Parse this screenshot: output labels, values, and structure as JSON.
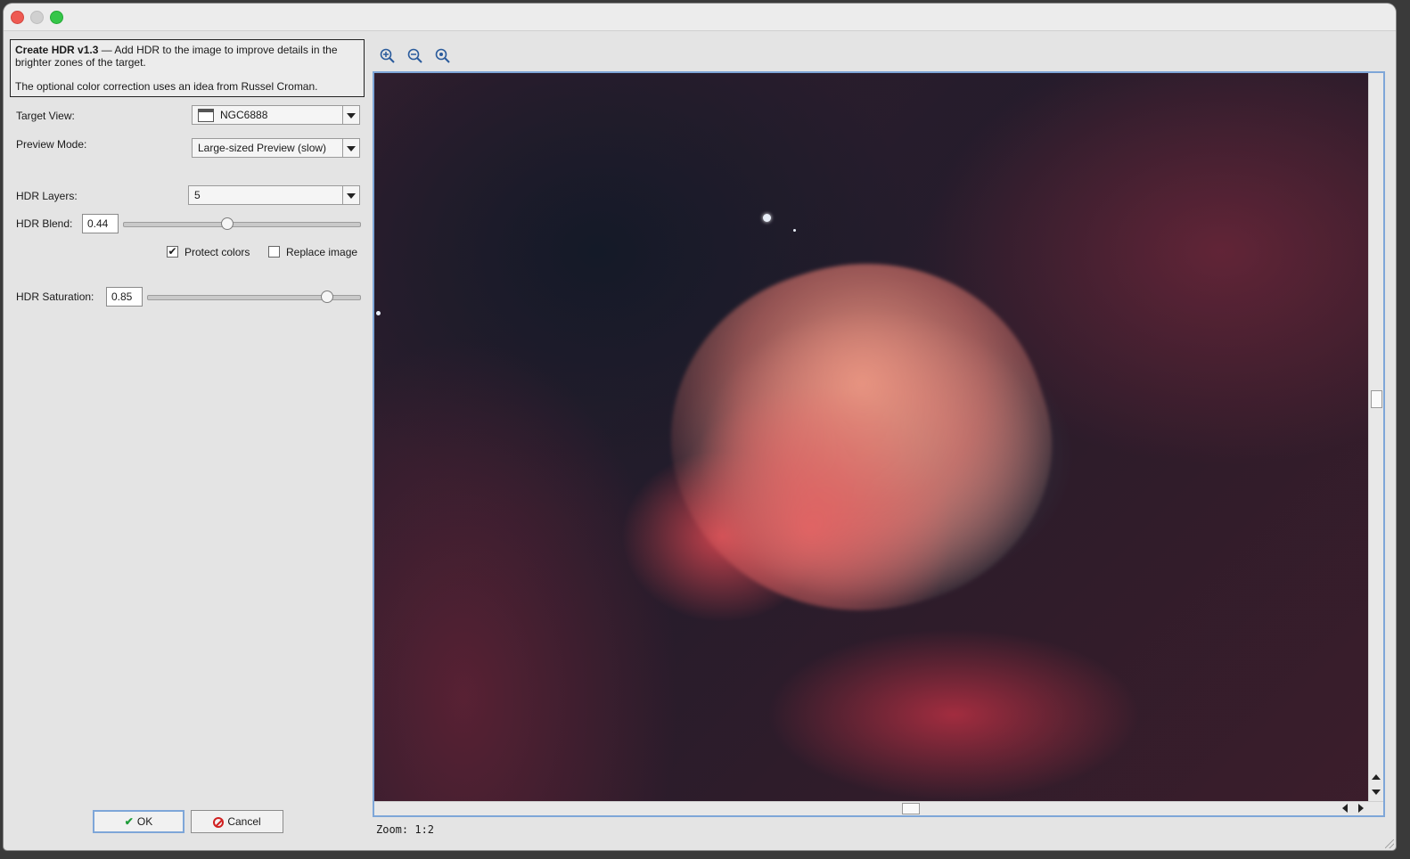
{
  "description": {
    "title": "Create HDR v1.3",
    "text": " — Add HDR to the image to improve details in the brighter zones of the target.",
    "note": "The optional color correction uses an idea from Russel Croman."
  },
  "target_view": {
    "label": "Target View:",
    "value": "NGC6888"
  },
  "preview_mode": {
    "label": "Preview Mode:",
    "value": "Large-sized Preview (slow)"
  },
  "hdr_layers": {
    "label": "HDR Layers:",
    "value": "5"
  },
  "hdr_blend": {
    "label": "HDR Blend:",
    "value": "0.44",
    "slider_fraction": 0.44
  },
  "protect_colors": {
    "label": "Protect colors",
    "checked": true
  },
  "replace_image": {
    "label": "Replace image",
    "checked": false
  },
  "hdr_saturation": {
    "label": "HDR Saturation:",
    "value": "0.85",
    "slider_fraction": 0.85
  },
  "buttons": {
    "ok": "OK",
    "cancel": "Cancel"
  },
  "toolbar": {
    "icons": [
      "zoom-in-icon",
      "zoom-out-icon",
      "zoom-fit-icon"
    ]
  },
  "zoom_status": "Zoom: 1:2"
}
